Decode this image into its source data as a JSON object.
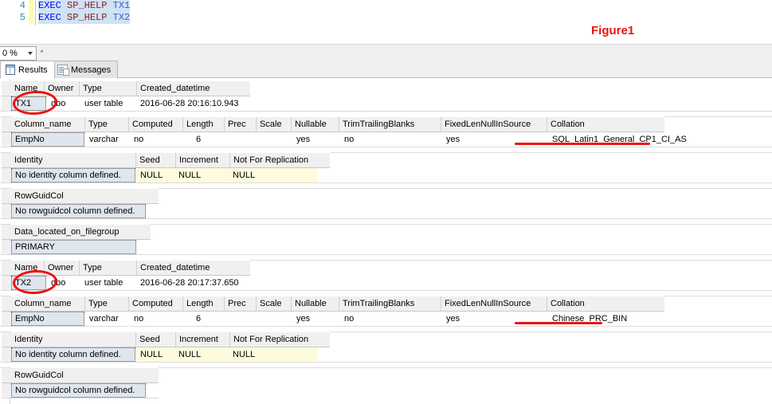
{
  "editor": {
    "lines": [
      {
        "no": "4",
        "kw": "EXEC",
        "proc": "SP_HELP",
        "ident": "TX1"
      },
      {
        "no": "5",
        "kw": "EXEC",
        "proc": "SP_HELP",
        "ident": "TX2"
      }
    ]
  },
  "zoombar": {
    "zoom_value": "0 %",
    "dropdown_icon": "chevron-down-icon"
  },
  "tabs": {
    "results": {
      "label": "Results",
      "icon": "grid-icon",
      "active": true
    },
    "messages": {
      "label": "Messages",
      "icon": "messages-icon",
      "active": false
    }
  },
  "annotations": {
    "figure_label": "Figure1",
    "accent_color": "#ee1111"
  },
  "grids": {
    "table1_info": {
      "headers": [
        "Name",
        "Owner",
        "Type",
        "Created_datetime"
      ],
      "rows": [
        [
          "TX1",
          "dbo",
          "user table",
          "2016-06-28 20:16:10.943"
        ]
      ]
    },
    "table1_columns": {
      "headers": [
        "Column_name",
        "Type",
        "Computed",
        "Length",
        "Prec",
        "Scale",
        "Nullable",
        "TrimTrailingBlanks",
        "FixedLenNullInSource",
        "Collation"
      ],
      "rows": [
        [
          "EmpNo",
          "varchar",
          "no",
          "6",
          "",
          "",
          "yes",
          "no",
          "yes",
          "SQL_Latin1_General_CP1_CI_AS"
        ]
      ]
    },
    "table1_identity": {
      "headers": [
        "Identity",
        "Seed",
        "Increment",
        "Not For Replication"
      ],
      "rows": [
        [
          "No identity column defined.",
          "NULL",
          "NULL",
          "NULL"
        ]
      ]
    },
    "table1_rowguidcol": {
      "headers": [
        "RowGuidCol"
      ],
      "rows": [
        [
          "No rowguidcol column defined."
        ]
      ]
    },
    "table1_filegroup": {
      "headers": [
        "Data_located_on_filegroup"
      ],
      "rows": [
        [
          "PRIMARY"
        ]
      ]
    },
    "table2_info": {
      "headers": [
        "Name",
        "Owner",
        "Type",
        "Created_datetime"
      ],
      "rows": [
        [
          "TX2",
          "dbo",
          "user table",
          "2016-06-28 20:17:37.650"
        ]
      ]
    },
    "table2_columns": {
      "headers": [
        "Column_name",
        "Type",
        "Computed",
        "Length",
        "Prec",
        "Scale",
        "Nullable",
        "TrimTrailingBlanks",
        "FixedLenNullInSource",
        "Collation"
      ],
      "rows": [
        [
          "EmpNo",
          "varchar",
          "no",
          "6",
          "",
          "",
          "yes",
          "no",
          "yes",
          "Chinese_PRC_BIN"
        ]
      ]
    },
    "table2_identity": {
      "headers": [
        "Identity",
        "Seed",
        "Increment",
        "Not For Replication"
      ],
      "rows": [
        [
          "No identity column defined.",
          "NULL",
          "NULL",
          "NULL"
        ]
      ]
    },
    "table2_rowguidcol": {
      "headers": [
        "RowGuidCol"
      ],
      "rows": [
        [
          "No rowguidcol column defined."
        ]
      ]
    }
  }
}
